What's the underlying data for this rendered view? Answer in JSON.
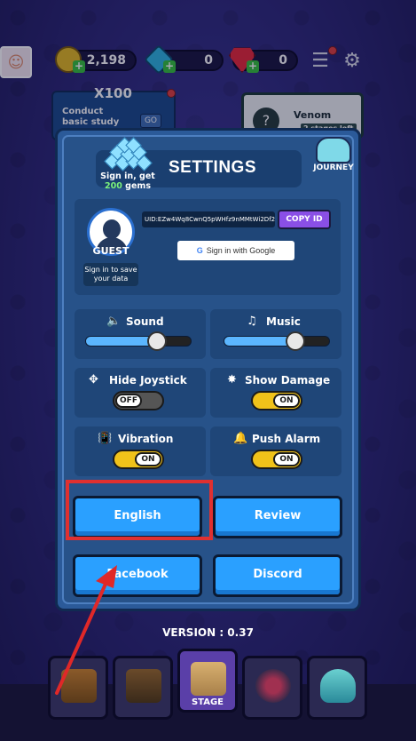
{
  "hud": {
    "gold": "2,198",
    "gems_blue": "0",
    "gems_red": "0"
  },
  "background_cards": {
    "quest_multiplier": "X100",
    "quest_text": "Conduct basic study",
    "quest_go": "GO",
    "boss_name": "Venom",
    "boss_stages": "2 stages left"
  },
  "settings": {
    "title": "SETTINGS",
    "gem_offer_line1": "Sign in, get",
    "gem_offer_amount": "200",
    "gem_offer_unit": "gems",
    "journey_label": "JOURNEY",
    "guest_label": "GUEST",
    "save_hint": "Sign in to save your data",
    "uid": "UID:EZw4Wq8CwnQ5pWHfz9nMMtWi2Df2",
    "copy_id_label": "COPY ID",
    "google_signin": "Sign in with Google",
    "sound_label": "Sound",
    "sound_level": 0.68,
    "music_label": "Music",
    "music_level": 0.68,
    "hide_joystick_label": "Hide Joystick",
    "hide_joystick_state": "OFF",
    "show_damage_label": "Show Damage",
    "show_damage_state": "ON",
    "vibration_label": "Vibration",
    "vibration_state": "ON",
    "push_alarm_label": "Push Alarm",
    "push_alarm_state": "ON",
    "english_button": "English",
    "review_button": "Review",
    "facebook_button": "Facebook",
    "discord_button": "Discord"
  },
  "version_text": "VERSION : 0.37",
  "bottom_nav": {
    "stage_label": "STAGE"
  },
  "colors": {
    "button_blue": "#2aa0ff",
    "toggle_on": "#f0c21a",
    "highlight_red": "#e03030",
    "panel_blue": "#2b5a99"
  }
}
